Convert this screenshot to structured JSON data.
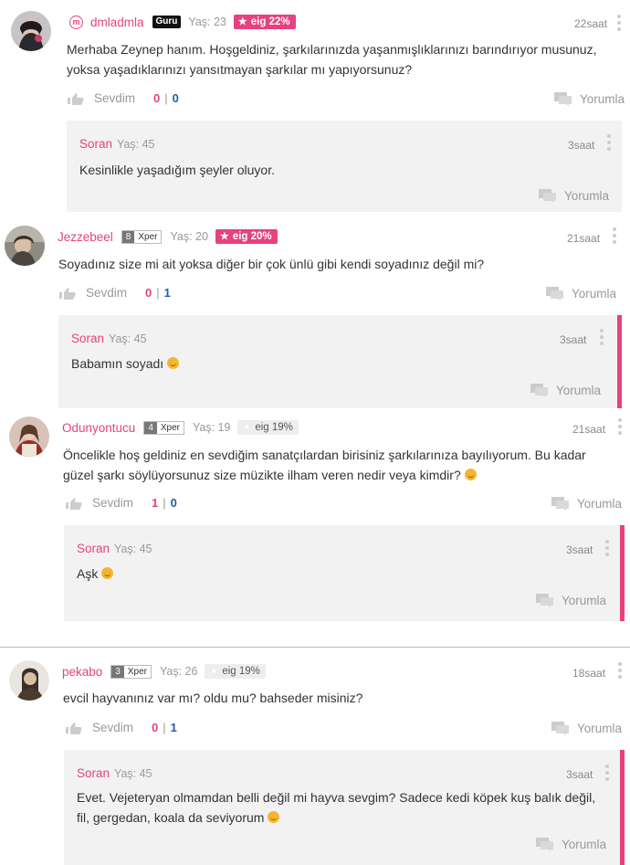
{
  "comments": [
    {
      "username": "dmladmla",
      "badge": "Guru",
      "age": "Yaş: 23",
      "eig": "eig 22%",
      "time": "22saat",
      "text": "Merhaba Zeynep hanım. Hoşgeldiniz, şarkılarınızda yaşanmışlıklarınızı barındırıyor musunuz, yoksa yaşadıklarınızı yansıtmayan şarkılar mı yapıyorsunuz?",
      "like_label": "Sevdim",
      "likes": "0",
      "dislikes": "0",
      "reply_label": "Yorumla",
      "reply": {
        "name": "Soran",
        "age": "Yaş: 45",
        "time": "3saat",
        "text": "Kesinlikle yaşadığım şeyler oluyor.",
        "reply_label": "Yorumla"
      }
    },
    {
      "username": "Jezzebeel",
      "level": "8",
      "level_label": "Xper",
      "age": "Yaş: 20",
      "eig": "eig 20%",
      "time": "21saat",
      "text": "Soyadınız size mi ait yoksa diğer bir çok ünlü gibi kendi soyadınız değil mi?",
      "like_label": "Sevdim",
      "likes": "0",
      "dislikes": "1",
      "reply_label": "Yorumla",
      "reply": {
        "name": "Soran",
        "age": "Yaş: 45",
        "time": "3saat",
        "text": "Babamın soyadı",
        "reply_label": "Yorumla"
      }
    },
    {
      "username": "Odunyontucu",
      "level": "4",
      "level_label": "Xper",
      "age": "Yaş: 19",
      "eig": "eig 19%",
      "time": "21saat",
      "text": "Öncelikle hoş geldiniz en sevdiğim sanatçılardan birisiniz şarkılarınıza bayılıyorum. Bu kadar güzel şarkı söylüyorsunuz size müzikte ilham veren nedir veya kimdir?",
      "like_label": "Sevdim",
      "likes": "1",
      "dislikes": "0",
      "reply_label": "Yorumla",
      "reply": {
        "name": "Soran",
        "age": "Yaş: 45",
        "time": "3saat",
        "text": "Aşk",
        "reply_label": "Yorumla"
      }
    },
    {
      "username": "pekabo",
      "level": "3",
      "level_label": "Xper",
      "age": "Yaş: 26",
      "eig": "eig 19%",
      "time": "18saat",
      "text": "evcil hayvanınız var mı? oldu mu? bahseder misiniz?",
      "like_label": "Sevdim",
      "likes": "0",
      "dislikes": "1",
      "reply_label": "Yorumla",
      "reply": {
        "name": "Soran",
        "age": "Yaş: 45",
        "time": "3saat",
        "text": "Evet. Vejeteryan olmamdan belli değil mi hayva sevgim? Sadece kedi köpek kuş balık değil, fil, gergedan, koala da seviyorum",
        "reply_label": "Yorumla"
      }
    }
  ],
  "colors": {
    "accent": "#e7417f",
    "dislike": "#1e5fa8",
    "reply_bg": "#f2f2f2"
  },
  "icons": [
    "m-logo-icon",
    "star-icon",
    "thumbs-up-icon",
    "comment-icon",
    "kebab-menu-icon",
    "smile-emoji-icon"
  ]
}
